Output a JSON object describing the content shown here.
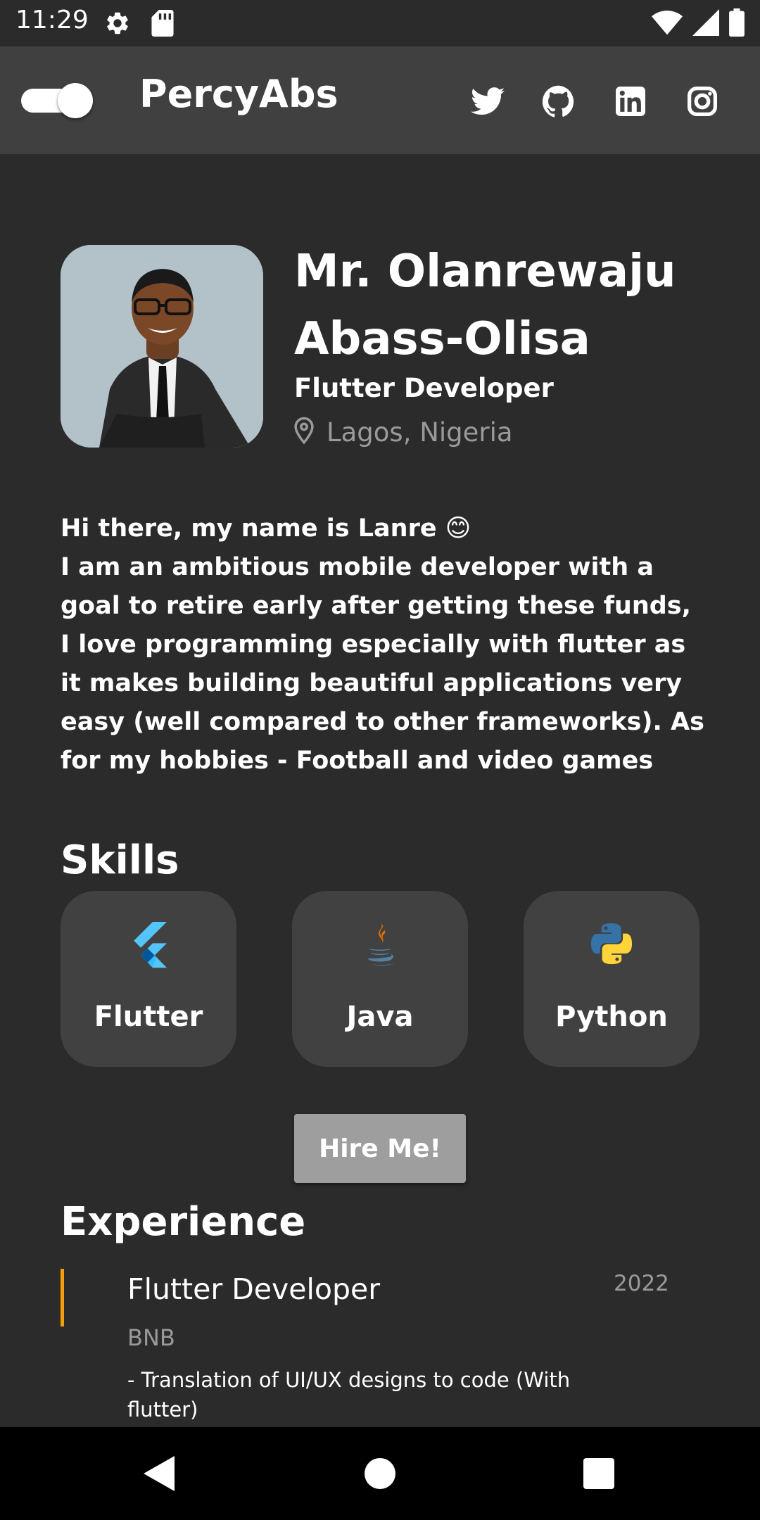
{
  "status_bar": {
    "time": "11:29",
    "icons": [
      "settings-icon",
      "sd-card-icon",
      "wifi-icon",
      "signal-icon",
      "battery-icon"
    ]
  },
  "app_bar": {
    "title": "PercyAbs",
    "theme_toggle": {
      "state": "on"
    },
    "social_links": [
      "twitter-icon",
      "github-icon",
      "linkedin-icon",
      "instagram-icon"
    ]
  },
  "profile": {
    "name": "Mr. Olanrewaju Abass-Olisa",
    "role": "Flutter Developer",
    "location": "Lagos, Nigeria",
    "bio": "Hi there, my name is Lanre 😊\nI am an ambitious mobile developer with a goal to retire early after getting these funds, I love programming especially with flutter as it makes building beautiful applications very easy (well compared to other frameworks). As for my hobbies - Football and video games"
  },
  "skills": {
    "heading": "Skills",
    "items": [
      {
        "label": "Flutter",
        "icon": "flutter-icon"
      },
      {
        "label": "Java",
        "icon": "java-icon"
      },
      {
        "label": "Python",
        "icon": "python-icon"
      }
    ]
  },
  "hire_button": {
    "label": "Hire Me!"
  },
  "experience": {
    "heading": "Experience",
    "items": [
      {
        "title": "Flutter Developer",
        "company": "BNB",
        "year": "2022",
        "description": "- Translation of UI/UX designs to code (With flutter)"
      }
    ]
  },
  "colors": {
    "background": "#2b2b2b",
    "app_bar": "#404040",
    "card": "#414141",
    "button": "#9e9e9e",
    "accent": "#f59e0b",
    "muted_text": "#9a9a9a"
  }
}
